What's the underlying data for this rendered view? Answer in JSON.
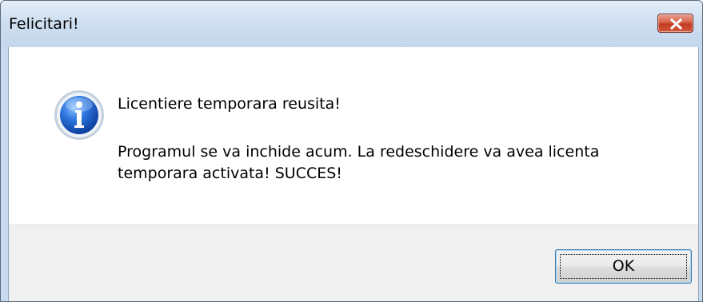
{
  "window": {
    "title": "Felicitari!"
  },
  "message": {
    "icon": "information-icon",
    "heading": "Licentiere temporara reusita!",
    "body": "Programul se va inchide acum. La redeschidere va avea licenta temporara activata! SUCCES!"
  },
  "buttons": {
    "ok_label": "OK"
  },
  "colors": {
    "titlebar": "#c9dcef",
    "close_button": "#c23a21",
    "content_bg": "#ffffff",
    "button_area_bg": "#f0f0f0",
    "button_focus_border": "#3c7fb1",
    "info_icon": "#1f5fc4"
  }
}
